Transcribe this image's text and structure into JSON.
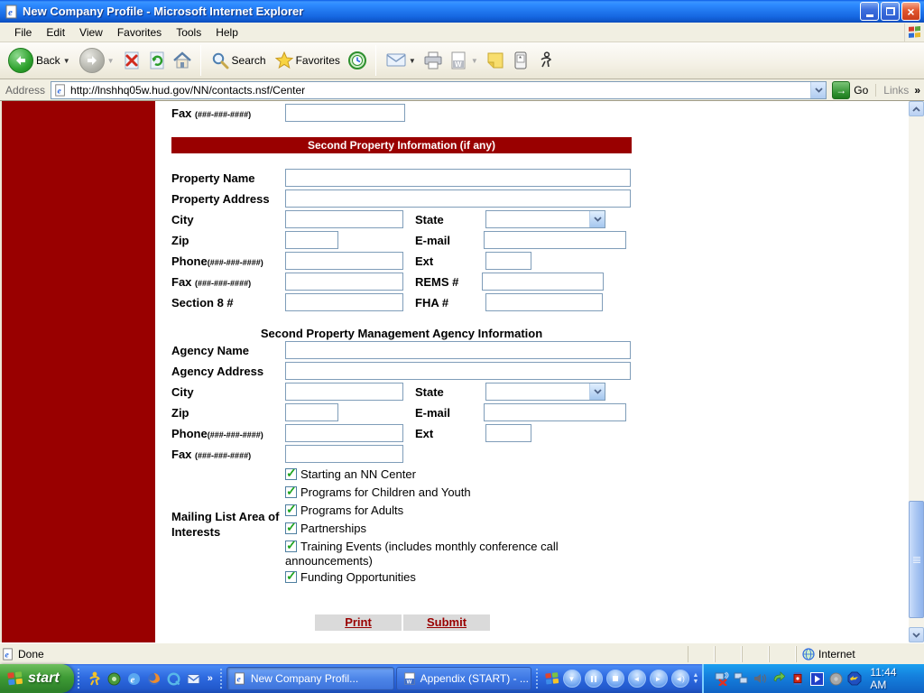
{
  "window": {
    "title": "New Company Profile - Microsoft Internet Explorer"
  },
  "menu": {
    "file": "File",
    "edit": "Edit",
    "view": "View",
    "favorites": "Favorites",
    "tools": "Tools",
    "help": "Help"
  },
  "toolbar": {
    "back": "Back",
    "search": "Search",
    "favorites": "Favorites"
  },
  "address": {
    "label": "Address",
    "url": "http://lnshhq05w.hud.gov/NN/contacts.nsf/Center",
    "go": "Go",
    "links": "Links",
    "links_chevron": "»"
  },
  "form": {
    "top_fax_label": "Fax",
    "top_fax_format": "(###-###-####)",
    "banner": "Second Property Information (if any)",
    "property": {
      "name_label": "Property Name",
      "address_label": "Property Address",
      "city_label": "City",
      "state_label": "State",
      "zip_label": "Zip",
      "email_label": "E-mail",
      "phone_label": "Phone",
      "phone_format": "(###-###-####)",
      "ext_label": "Ext",
      "fax_label": "Fax",
      "fax_format": "(###-###-####)",
      "rems_label": "REMS #",
      "section8_label": "Section 8 #",
      "fha_label": "FHA #"
    },
    "agency_heading": "Second Property Management Agency Information",
    "agency": {
      "name_label": "Agency Name",
      "address_label": "Agency Address",
      "city_label": "City",
      "state_label": "State",
      "zip_label": "Zip",
      "email_label": "E-mail",
      "phone_label": "Phone",
      "phone_format": "(###-###-####)",
      "ext_label": "Ext",
      "fax_label": "Fax",
      "fax_format": "(###-###-####)"
    },
    "mailing": {
      "label": "Mailing List Area of Interests",
      "options": [
        {
          "label": "Starting an NN Center",
          "checked": true
        },
        {
          "label": "Programs for Children and Youth",
          "checked": true
        },
        {
          "label": "Programs for Adults",
          "checked": true
        },
        {
          "label": "Partnerships",
          "checked": true
        },
        {
          "label": "Training Events (includes monthly conference call announcements)",
          "checked": true
        },
        {
          "label": "Funding Opportunities",
          "checked": true
        }
      ]
    },
    "print_button": "Print",
    "submit_button": "Submit"
  },
  "status": {
    "message": "Done",
    "zone": "Internet"
  },
  "taskbar": {
    "start_label": "start",
    "quick_launch_chevron": "»",
    "task1": "New Company Profil...",
    "task2": "Appendix (START) - ...",
    "clock": "11:44 AM"
  },
  "colors": {
    "accent_red": "#990000",
    "xp_title_blue": "#1566E0",
    "taskbar_blue": "#2E6AE0",
    "go_green": "#2E8F2E",
    "check_green": "#1FA51F",
    "input_border": "#7F9DB9"
  }
}
